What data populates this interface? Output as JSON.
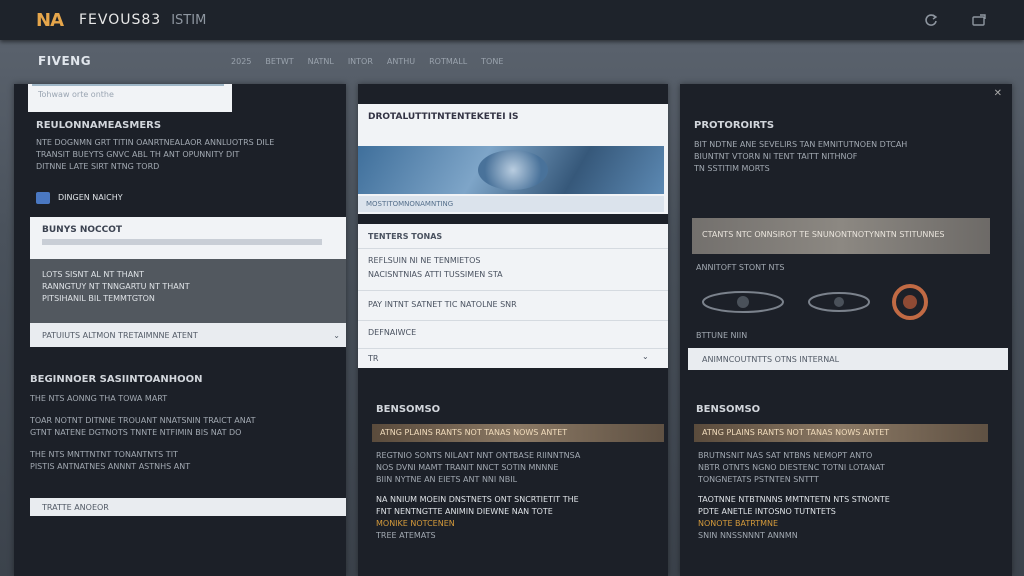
{
  "app": {
    "logo": "NA",
    "title": "FEVOUS83",
    "subtitle": "ISTIM"
  },
  "section": {
    "title": "FIVENG",
    "tabs": [
      "2025",
      "BETWT",
      "NATNL",
      "INTOR",
      "ANTHU",
      "ROTMALL",
      "TONE"
    ]
  },
  "col1": {
    "search_placeholder": "Tohwaw orte onthe",
    "heading": "REULONNAMEASMERS",
    "lines": [
      "NTE DOGNMN GRT TITIN OANRTNEALAOR ANNLUOTRS DILE",
      "TRANSIT BUEYTS GNVC ABL TH ANT OPUNNITY DIT",
      "DITNNE LATE SIRT NTNG TORD"
    ],
    "tag": "DINGEN NAICHY",
    "card_title": "BUNYS NOCCOT",
    "gray_text": [
      "LOTS SISNT AL NT THANT",
      "RANNGTUY NT TNNGARTU NT THANT",
      "PITSIHANIL BIL TEMMTGTON"
    ],
    "bar_text": "PATUIUTS ALTMON TRETAIMNNE ATENT",
    "bottom_heading": "BEGINNOER SASIINTOANHOON",
    "bottom_lines": [
      "THE NTS AONNG THA TOWA MART",
      "TOAR NOTNT DITNNE TROUANT NNATSNIN TRAICT ANAT",
      "GTNT NATENE DGTNOTS TNNTE NTFIMIN BIS NAT DO",
      "THE NTS MNTTNTNT TONANTNTS TIT",
      "PISTIS ANTNATNES ANNNT ASTNHS ANT"
    ],
    "bottom_button": "TRATTE ANOEOR"
  },
  "col2": {
    "header": "DROTALUTTITNTENTEKETEI IS",
    "strip": "MOSTITOMNONAMNTING",
    "list_rows": [
      "TENTERS TONAS",
      "REFLSUIN  NI NE TENMIETOS",
      "NACISNTNIAS ATTI TUSSIMEN STA",
      "PAY INTNT SATNET TIC NATOLNE SNR",
      "DEFNAIWCE"
    ],
    "list_footer": "TR",
    "sec_heading": "BENSOMSO",
    "brown": "ATNG PLAINS RANTS NOT TANAS NOWS ANTET",
    "lines": [
      "REGTNIO SONTS NILANT NNT ONTBASE RIINNTNSA",
      "NOS DVNI MAMT TRANIT NNCT SOTIN MNNNE",
      "BIIN NYTNE AN EIETS ANT NNI NBIL",
      "NA NNIUM MOEIN DNSTNETS ONT SNCRTIETIT THE",
      "FNT NENTNGTTE ANIMIN DIEWNE NAN TOTE",
      "MONIKE NOTCENEN",
      "TREE ATEMATS"
    ]
  },
  "col3": {
    "heading": "PROTOROIRTS",
    "lines": [
      "BIT NDTNE ANE SEVELIRS TAN EMNITUTNOEN DTCAH",
      "BIUNTNT VTORN NI TENT TAITT NITHNOF",
      "TN SSTITIM MORTS"
    ],
    "gray_card_text": "CTANTS NTC ONNSIROT TE SNUNONTNOTYNNTN STITUNNES",
    "media_caption": "ANNITOFT STONT NTS",
    "media_footer": "BTTUNE NIIN",
    "bar_text": "ANIMNCOUTNTTS OTNS INTERNAL",
    "sec_heading": "BENSOMSO",
    "brown": "ATNG PLAINS RANTS NOT TANAS NOWS ANTET",
    "lines2": [
      "BRUTNSNIT NAS SAT NTBNS NEMOPT ANTO",
      "NBTR OTNTS NGNO DIESTENC TOTNI LOTANAT",
      "TONGNETATS PSTNTEN SNTTT",
      "TAOTNNE NTBTNNNS MMTNTETN NTS STNONTE",
      "PDTE ANETLE INTOSNO TUTNTETS",
      "NONOTE BATRTMNE",
      "SNIN NNSSNNNT ANNMN"
    ]
  },
  "colors": {
    "accent": "#e6a64b",
    "panel": "#1c2028",
    "topbar": "#1e232b"
  }
}
